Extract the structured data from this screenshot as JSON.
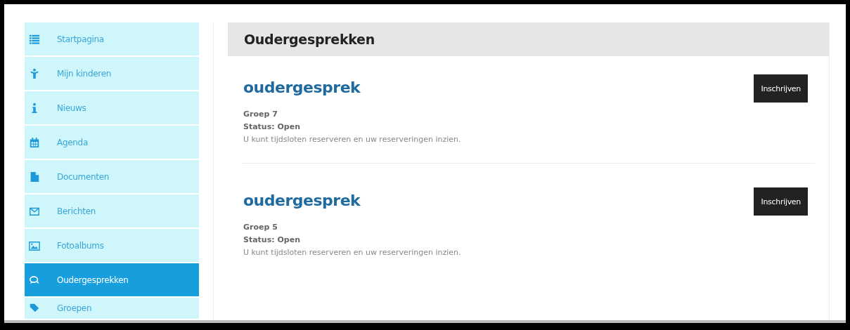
{
  "sidebar": {
    "items": [
      {
        "label": "Startpagina",
        "selected": false
      },
      {
        "label": "Mijn kinderen",
        "selected": false
      },
      {
        "label": "Nieuws",
        "selected": false
      },
      {
        "label": "Agenda",
        "selected": false
      },
      {
        "label": "Documenten",
        "selected": false
      },
      {
        "label": "Berichten",
        "selected": false
      },
      {
        "label": "Fotoalbums",
        "selected": false
      },
      {
        "label": "Oudergesprekken",
        "selected": true
      },
      {
        "label": "Groepen",
        "selected": false
      }
    ]
  },
  "page": {
    "title": "Oudergesprekken",
    "items": [
      {
        "title": "oudergesprek",
        "group": "Groep 7",
        "status": "Status: Open",
        "description": "U kunt tijdsloten reserveren en uw reserveringen inzien.",
        "button": "Inschrijven"
      },
      {
        "title": "oudergesprek",
        "group": "Groep 5",
        "status": "Status: Open",
        "description": "U kunt tijdsloten reserveren en uw reserveringen inzien.",
        "button": "Inschrijven"
      }
    ]
  }
}
